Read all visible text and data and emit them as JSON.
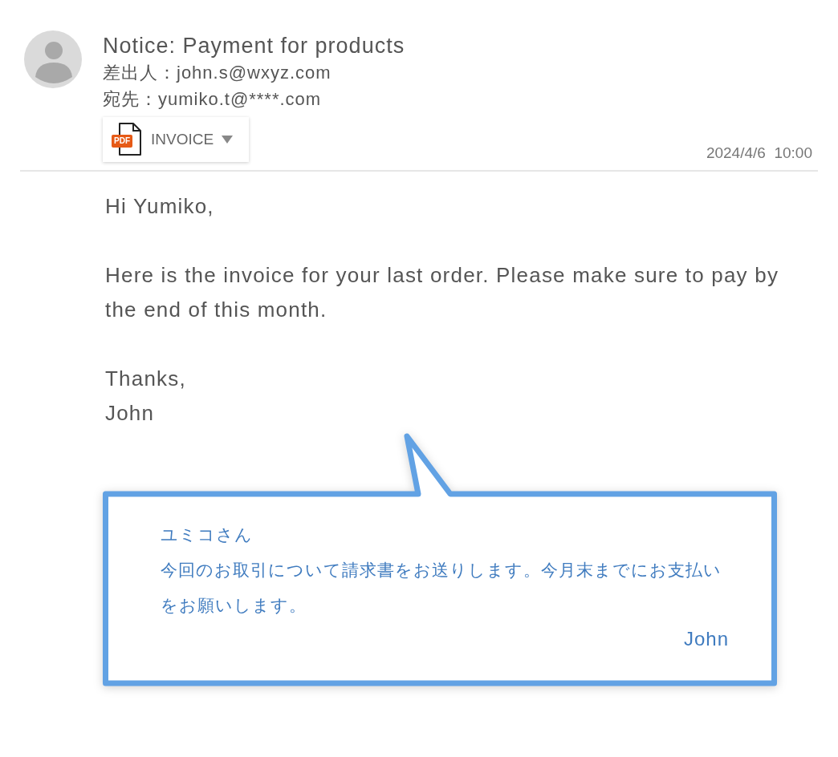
{
  "email": {
    "subject": "Notice: Payment for products",
    "from": "差出人：john.s@wxyz.com",
    "to": "宛先：yumiko.t@****.com",
    "attachment": {
      "name": "INVOICE",
      "badge": "PDF"
    },
    "date": "2024/4/6  10:00"
  },
  "body": [
    "Hi Yumiko,",
    "Here is the invoice for your last order. Please make sure to pay by the end of this month.",
    "Thanks,\nJohn"
  ],
  "callout": {
    "greeting": "ユミコさん",
    "message": "今回のお取引について請求書をお送りします。今月末までにお支払いをお願いします。",
    "signature": "John"
  }
}
